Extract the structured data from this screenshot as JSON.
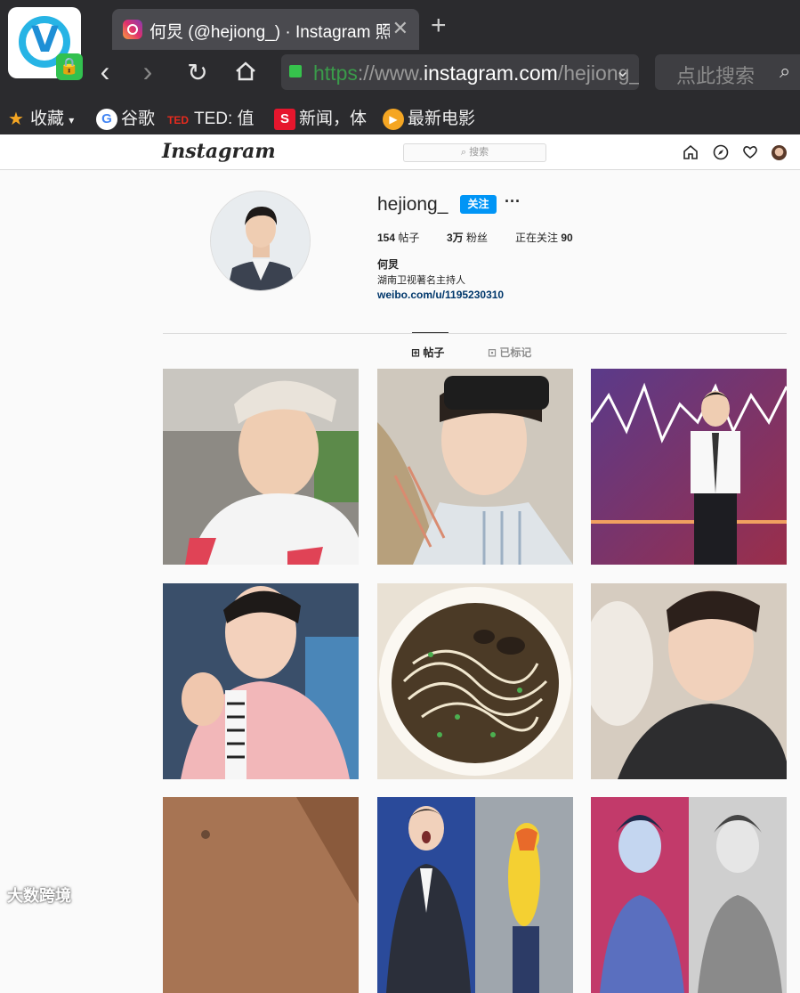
{
  "browser": {
    "tab_title": "何炅 (@hejiong_) · Instagram 照片",
    "new_tab_symbol": "+",
    "url_scheme": "https",
    "url_sep": "://www.",
    "url_host": "instagram.com",
    "url_path": "/hejiong_/",
    "search_placeholder": "点此搜索",
    "bookmarks": [
      {
        "label": "收藏",
        "icon": "star-icon"
      },
      {
        "label": "谷歌",
        "icon": "google-icon"
      },
      {
        "label": "TED: 值",
        "icon": "ted-icon",
        "badge": "TED"
      },
      {
        "label": "新闻，体",
        "icon": "sina-icon",
        "badge": "S"
      },
      {
        "label": "最新电影",
        "icon": "video-icon"
      }
    ]
  },
  "instagram": {
    "logo": "Instagram",
    "search_placeholder": "搜索"
  },
  "profile": {
    "username": "hejiong_",
    "follow_label": "关注",
    "more_label": "···",
    "posts_count": "154",
    "posts_label": "帖子",
    "followers_count": "3万",
    "followers_label": "粉丝",
    "following_label": "正在关注",
    "following_count": "90",
    "full_name": "何炅",
    "bio": "湖南卫视著名主持人",
    "link": "weibo.com/u/1195230310"
  },
  "tabs": {
    "posts": "帖子",
    "tagged": "已标记"
  },
  "watermark": "大数跨境",
  "colors": {
    "follow_blue": "#0095f6",
    "link_blue": "#00376b",
    "url_green": "#3a9b4a"
  }
}
